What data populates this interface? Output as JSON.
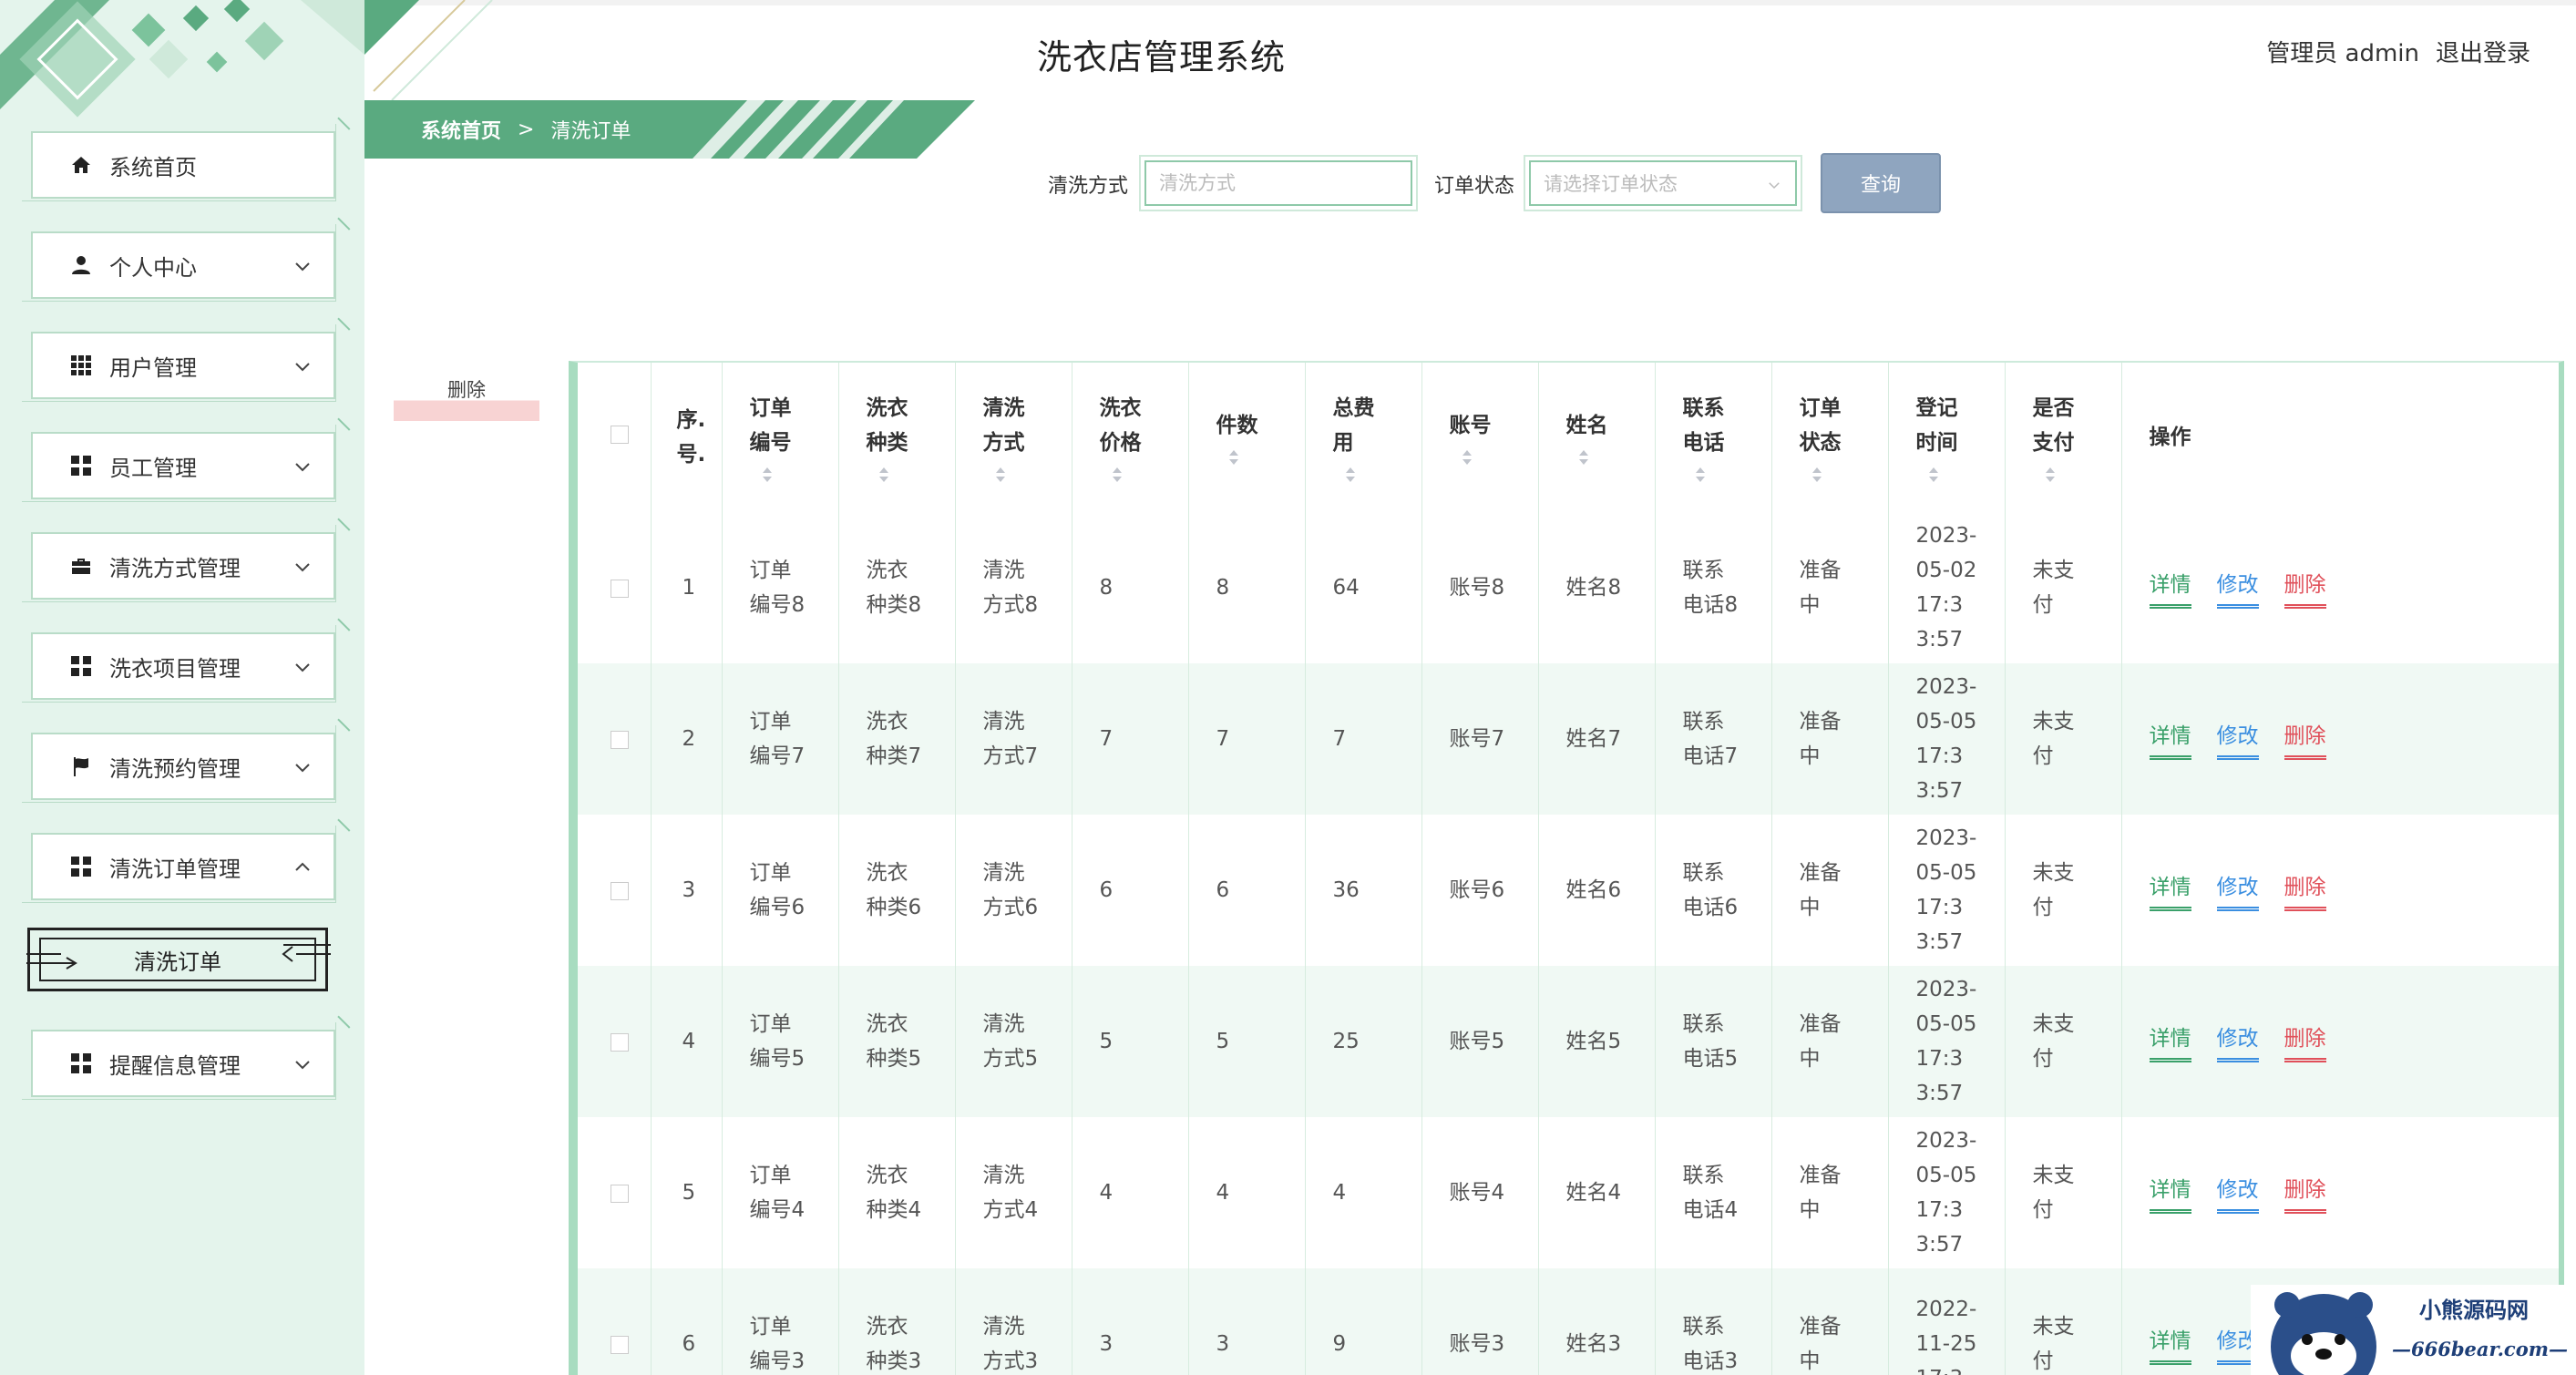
{
  "app": {
    "title": "洗衣店管理系统",
    "admin_label": "管理员 admin",
    "logout_label": "退出登录"
  },
  "breadcrumb": {
    "home": "系统首页",
    "separator": ">",
    "current": "清洗订单"
  },
  "sidebar": {
    "items": [
      {
        "label": "系统首页",
        "icon": "home-icon"
      },
      {
        "label": "个人中心",
        "icon": "user-icon"
      },
      {
        "label": "用户管理",
        "icon": "grid-icon"
      },
      {
        "label": "员工管理",
        "icon": "apps-icon"
      },
      {
        "label": "清洗方式管理",
        "icon": "briefcase-icon"
      },
      {
        "label": "洗衣项目管理",
        "icon": "apps-icon"
      },
      {
        "label": "清洗预约管理",
        "icon": "flag-icon"
      },
      {
        "label": "清洗订单管理",
        "icon": "apps-icon"
      },
      {
        "label": "提醒信息管理",
        "icon": "apps-icon"
      }
    ],
    "subitem": "清洗订单"
  },
  "search": {
    "method_label": "清洗方式",
    "method_placeholder": "清洗方式",
    "status_label": "订单状态",
    "status_placeholder": "请选择订单状态",
    "query_button": "查询"
  },
  "actions": {
    "delete_button": "删除"
  },
  "table": {
    "headers": {
      "index": "序.\n号.",
      "order_no": "订单\n编号",
      "cloth_type": "洗衣\n种类",
      "wash_method": "清洗\n方式",
      "price": "洗衣\n价格",
      "count": "件数",
      "total": "总费\n用",
      "account": "账号",
      "name": "姓名",
      "phone": "联系\n电话",
      "status": "订单\n状态",
      "reg_time": "登记\n时间",
      "paid": "是否\n支付",
      "ops": "操作"
    },
    "rows": [
      {
        "index": "1",
        "order_no": "订单\n编号8",
        "cloth_type": "洗衣\n种类8",
        "wash_method": "清洗\n方式8",
        "price": "8",
        "count": "8",
        "total": "64",
        "account": "账号8",
        "name": "姓名8",
        "phone": "联系\n电话8",
        "status": "准备\n中",
        "reg_time": "2023-\n05-02\n17:3\n3:57",
        "paid": "未支\n付"
      },
      {
        "index": "2",
        "order_no": "订单\n编号7",
        "cloth_type": "洗衣\n种类7",
        "wash_method": "清洗\n方式7",
        "price": "7",
        "count": "7",
        "total": "7",
        "account": "账号7",
        "name": "姓名7",
        "phone": "联系\n电话7",
        "status": "准备\n中",
        "reg_time": "2023-\n05-05\n17:3\n3:57",
        "paid": "未支\n付"
      },
      {
        "index": "3",
        "order_no": "订单\n编号6",
        "cloth_type": "洗衣\n种类6",
        "wash_method": "清洗\n方式6",
        "price": "6",
        "count": "6",
        "total": "36",
        "account": "账号6",
        "name": "姓名6",
        "phone": "联系\n电话6",
        "status": "准备\n中",
        "reg_time": "2023-\n05-05\n17:3\n3:57",
        "paid": "未支\n付"
      },
      {
        "index": "4",
        "order_no": "订单\n编号5",
        "cloth_type": "洗衣\n种类5",
        "wash_method": "清洗\n方式5",
        "price": "5",
        "count": "5",
        "total": "25",
        "account": "账号5",
        "name": "姓名5",
        "phone": "联系\n电话5",
        "status": "准备\n中",
        "reg_time": "2023-\n05-05\n17:3\n3:57",
        "paid": "未支\n付"
      },
      {
        "index": "5",
        "order_no": "订单\n编号4",
        "cloth_type": "洗衣\n种类4",
        "wash_method": "清洗\n方式4",
        "price": "4",
        "count": "4",
        "total": "4",
        "account": "账号4",
        "name": "姓名4",
        "phone": "联系\n电话4",
        "status": "准备\n中",
        "reg_time": "2023-\n05-05\n17:3\n3:57",
        "paid": "未支\n付"
      },
      {
        "index": "6",
        "order_no": "订单\n编号3",
        "cloth_type": "洗衣\n种类3",
        "wash_method": "清洗\n方式3",
        "price": "3",
        "count": "3",
        "total": "9",
        "account": "账号3",
        "name": "姓名3",
        "phone": "联系\n电话3",
        "status": "准备\n中",
        "reg_time": "2022-\n11-25\n17:3",
        "paid": "未支\n付"
      }
    ],
    "ops": {
      "detail": "详情",
      "edit": "修改",
      "delete": "删除"
    }
  },
  "watermark": {
    "line1": "小熊源码网",
    "line2": "—666bear.com—"
  },
  "colors": {
    "accent_green": "#5aaa80",
    "sidebar_bg": "#e4f4ec",
    "query_button": "#8fa5bf",
    "detail": "#3aa06a",
    "edit": "#3a8ee0",
    "delete": "#e0505a"
  }
}
